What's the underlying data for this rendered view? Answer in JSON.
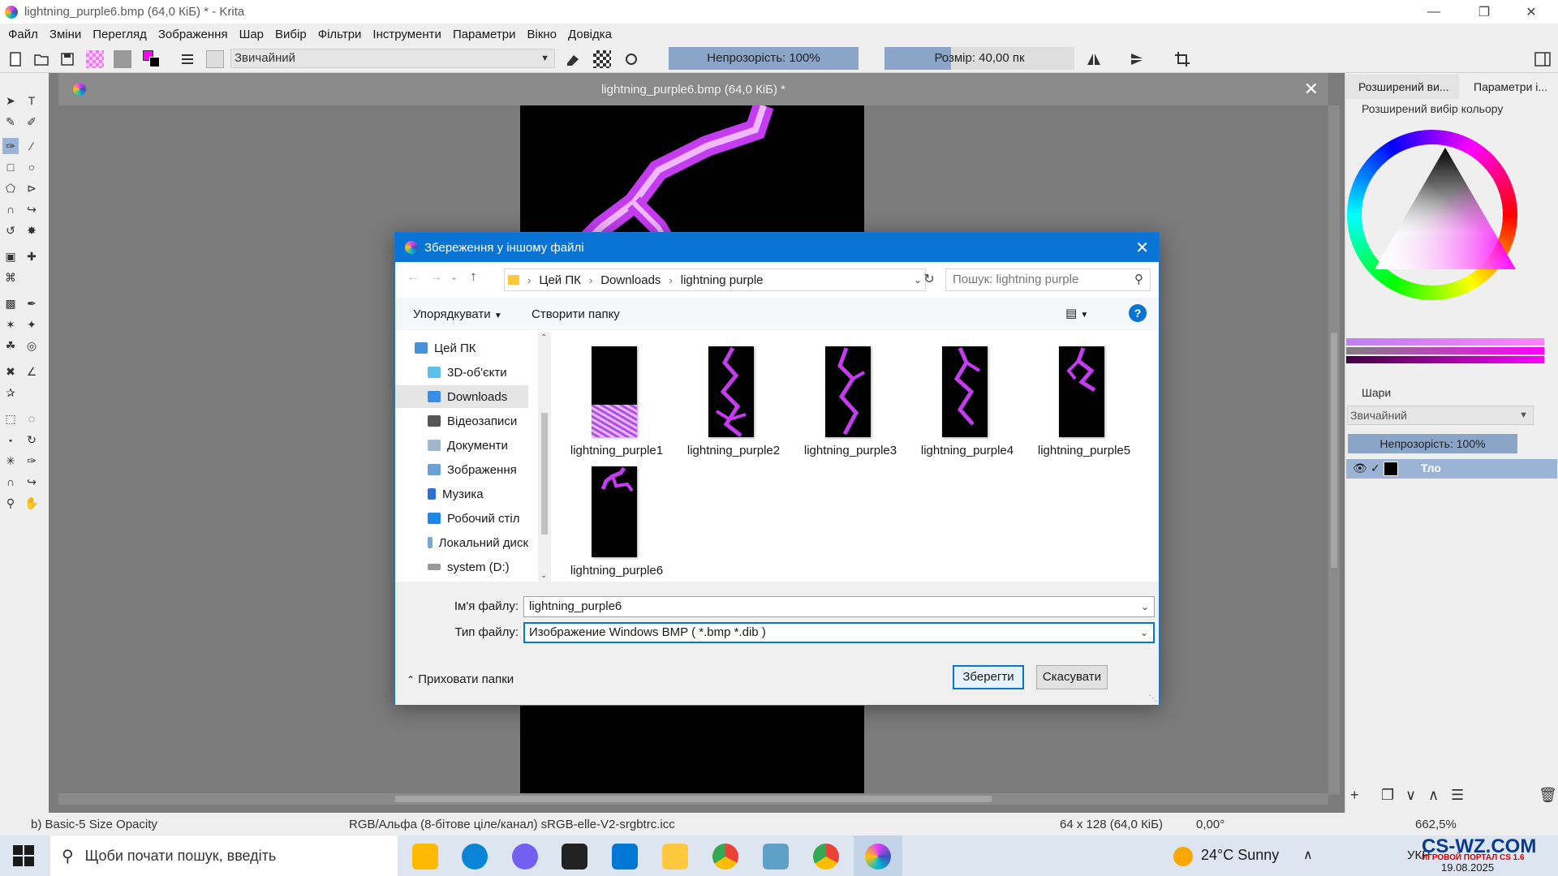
{
  "window": {
    "title": "lightning_purple6.bmp (64,0 КіБ) * - Krita"
  },
  "menu": [
    "Файл",
    "Зміни",
    "Перегляд",
    "Зображення",
    "Шар",
    "Вибір",
    "Фільтри",
    "Інструменти",
    "Параметри",
    "Вікно",
    "Довідка"
  ],
  "toolbar": {
    "brush_preset": "Звичайний",
    "opacity": "Непрозорість: 100%",
    "opacity_value": 1.0,
    "size": "Розмір: 40,00 пк",
    "size_fill_fraction": 0.35
  },
  "document": {
    "tab_title": "lightning_purple6.bmp (64,0 КіБ) *"
  },
  "right_panel": {
    "tab1": "Розширений ви...",
    "tab2": "Параметри і...",
    "color_header": "Розширений вибір кольору",
    "layers_header": "Шари",
    "blend_mode": "Звичайний",
    "layer_opacity": "Непрозорість:  100%",
    "layer_name": "Тло"
  },
  "statusbar": {
    "brush": "b) Basic-5 Size Opacity",
    "color_space": "RGB/Альфа (8-бітове ціле/канал)  sRGB-elle-V2-srgbtrc.icc",
    "dimensions": "64 x 128 (64,0 КіБ)",
    "rotation": "0,00°",
    "zoom": "662,5%"
  },
  "taskbar": {
    "search_placeholder": "Щоби почати пошук, введіть",
    "weather": "24°C  Sunny",
    "language": "УКР",
    "date": "19.08.2025",
    "watermark": "CS-WZ.COM",
    "watermark_sub": "ИГРОВОЙ ПОРТАЛ CS 1.6"
  },
  "dialog": {
    "title": "Збереження у іншому файлі",
    "path": [
      "Цей ПК",
      "Downloads",
      "lightning purple"
    ],
    "search_placeholder": "Пошук: lightning purple",
    "organize": "Упорядкувати",
    "new_folder": "Створити папку",
    "nav_items": [
      {
        "label": "Цей ПК",
        "icon": "computer-icon"
      },
      {
        "label": "3D-об'єкти",
        "icon": "3d-objects-icon"
      },
      {
        "label": "Downloads",
        "icon": "downloads-icon"
      },
      {
        "label": "Відеозаписи",
        "icon": "videos-icon"
      },
      {
        "label": "Документи",
        "icon": "documents-icon"
      },
      {
        "label": "Зображення",
        "icon": "pictures-icon"
      },
      {
        "label": "Музика",
        "icon": "music-icon"
      },
      {
        "label": "Робочий стіл",
        "icon": "desktop-icon"
      },
      {
        "label": "Локальний диск",
        "icon": "local-disk-icon"
      },
      {
        "label": "system (D:)",
        "icon": "drive-icon"
      }
    ],
    "files": [
      "lightning_purple1",
      "lightning_purple2",
      "lightning_purple3",
      "lightning_purple4",
      "lightning_purple5",
      "lightning_purple6"
    ],
    "filename_label": "Ім'я файлу:",
    "filename_value": "lightning_purple6",
    "filetype_label": "Тип файлу:",
    "filetype_value": "Изображение Windows BMP ( *.bmp *.dib )",
    "hide_folders": "Приховати папки",
    "save": "Зберегти",
    "cancel": "Скасувати"
  },
  "colors": {
    "dialog_accent": "#0a74d4",
    "lightning": "#c43cf0",
    "selection": "#8ba5c8"
  }
}
